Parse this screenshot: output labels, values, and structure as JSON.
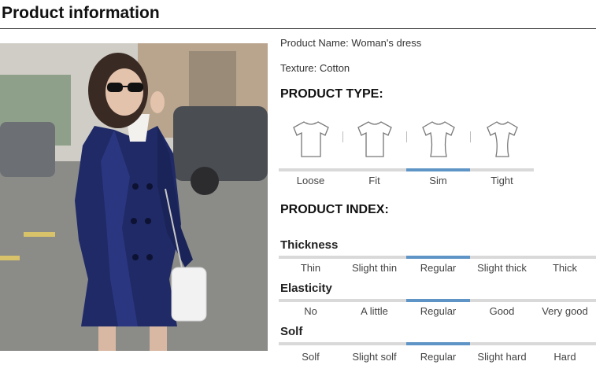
{
  "header": {
    "title": "Product information"
  },
  "product": {
    "name_line": "Product Name: Woman's dress",
    "texture_line": "Texture: Cotton"
  },
  "product_type": {
    "title": "PRODUCT TYPE:",
    "options": [
      "Loose",
      "Fit",
      "Sim",
      "Tight"
    ],
    "selected_index": 2,
    "icon": "t-shirt-icon"
  },
  "product_index": {
    "title": "PRODUCT INDEX:",
    "scales": [
      {
        "name": "Thickness",
        "options": [
          "Thin",
          "Slight thin",
          "Regular",
          "Slight thick",
          "Thick"
        ],
        "selected_index": 2
      },
      {
        "name": "Elasticity",
        "options": [
          "No",
          "A little",
          "Regular",
          "Good",
          "Very good"
        ],
        "selected_index": 2
      },
      {
        "name": "Solf",
        "options": [
          "Solf",
          "Slight solf",
          "Regular",
          "Slight hard",
          "Hard"
        ],
        "selected_index": 2
      }
    ]
  },
  "colors": {
    "accent": "#5f95c6",
    "track": "#d9d9d9",
    "coat": "#1f2a66"
  }
}
